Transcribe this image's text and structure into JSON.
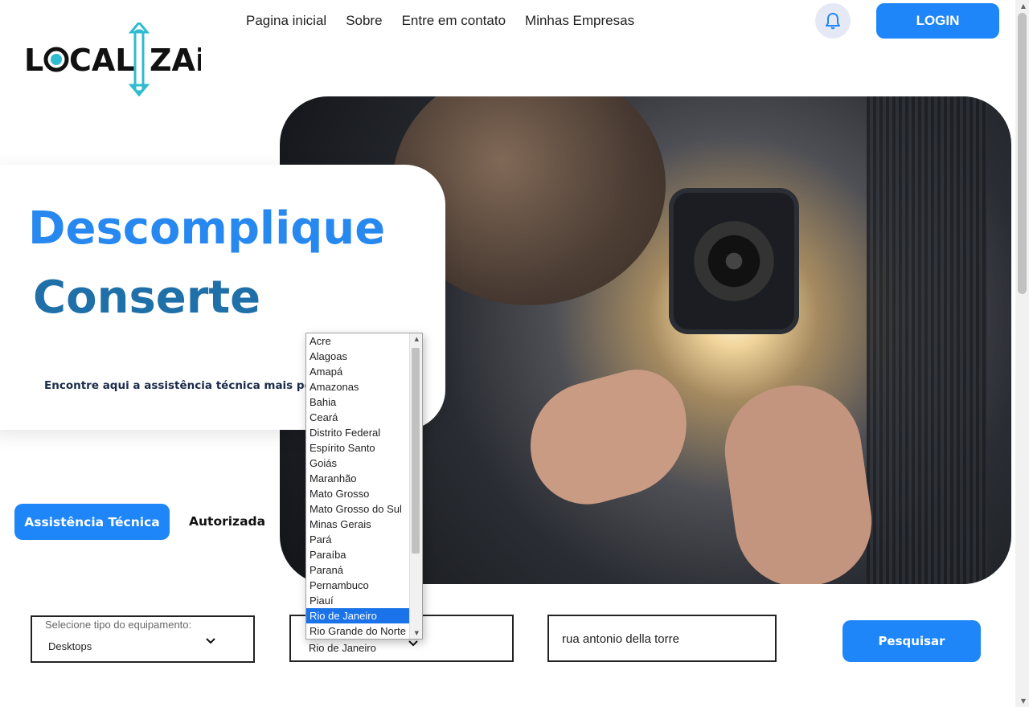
{
  "brand": {
    "logo_text": "LOCALIZAi"
  },
  "nav": {
    "items": [
      {
        "label": "Pagina inicial"
      },
      {
        "label": "Sobre"
      },
      {
        "label": "Entre em contato"
      },
      {
        "label": "Minhas Empresas"
      }
    ]
  },
  "header": {
    "bell_icon": "bell-icon",
    "login_label": "LOGIN"
  },
  "hero": {
    "headline_1": "Descomplique",
    "headline_2": "Conserte",
    "subtitle": "Encontre aqui a assistência técnica mais perto de você"
  },
  "tabs": {
    "active": "Assistência Técnica",
    "other": "Autorizada"
  },
  "search": {
    "equipment_label": "Selecione tipo do equipamento:",
    "equipment_value": "Desktops",
    "state_value": "Rio de Janeiro",
    "address_value": "rua antonio della torre",
    "button_label": "Pesquisar"
  },
  "state_dropdown": {
    "options": [
      "Acre",
      "Alagoas",
      "Amapá",
      "Amazonas",
      "Bahia",
      "Ceará",
      "Distrito Federal",
      "Espírito Santo",
      "Goiás",
      "Maranhão",
      "Mato Grosso",
      "Mato Grosso do Sul",
      "Minas Gerais",
      "Pará",
      "Paraíba",
      "Paraná",
      "Pernambuco",
      "Piauí",
      "Rio de Janeiro",
      "Rio Grande do Norte"
    ],
    "selected": "Rio de Janeiro"
  },
  "colors": {
    "accent": "#1e86f8",
    "headline_1": "#2788f0",
    "headline_2": "#1f6fa8",
    "logo_accent": "#2fbcd1"
  }
}
